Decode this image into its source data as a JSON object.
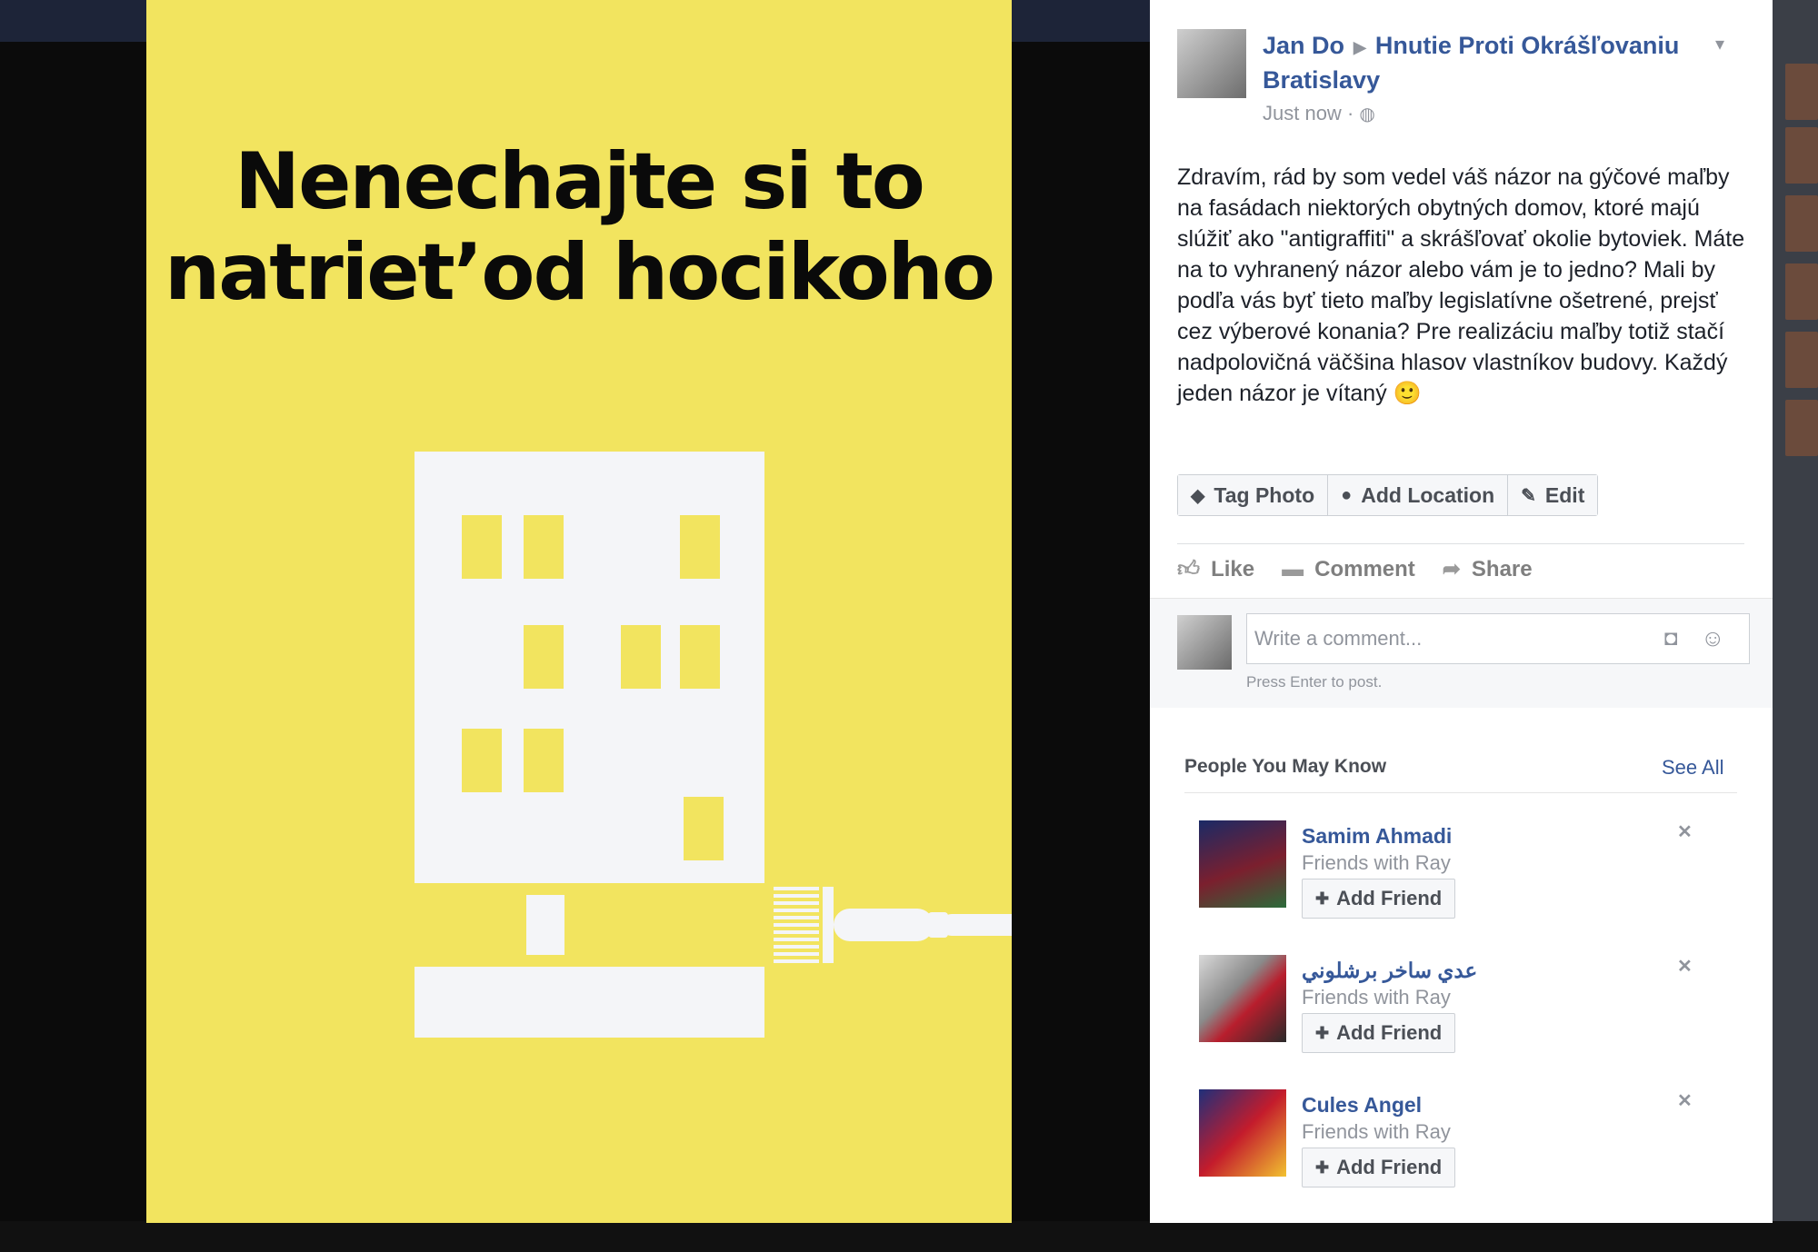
{
  "poster": {
    "line1": "Nenechajte si to",
    "line2": "natriet’od hocikoho",
    "background_color": "#f2e45f",
    "building_color": "#f4f5f8"
  },
  "post": {
    "author": "Jan Do",
    "group": "Hnutie Proti Okrášľovaniu Bratislavy",
    "time": "Just now",
    "separator": "·",
    "text": "Zdravím, rád by som vedel váš názor na gýčové maľby na fasádach niektorých obytných domov, ktoré majú slúžiť ako \"antigraffiti\" a skrášľovať okolie bytoviek. Máte na to vyhranený názor alebo vám je to jedno? Mali by podľa vás byť tieto maľby legislatívne ošetrené, prejsť cez výberové konania? Pre realizáciu maľby totiž stačí nadpolovičná väčšina hlasov vlastníkov budovy. Každý jeden názor je vítaný 🙂"
  },
  "toolbar": {
    "tag_photo": "Tag Photo",
    "add_location": "Add Location",
    "edit": "Edit"
  },
  "actions": {
    "like": "Like",
    "comment": "Comment",
    "share": "Share"
  },
  "comment_box": {
    "placeholder": "Write a comment...",
    "hint": "Press Enter to post."
  },
  "pymk": {
    "title": "People You May Know",
    "see_all": "See All",
    "people": [
      {
        "name": "Samim Ahmadi",
        "sub": "Friends with Ray",
        "button": "Add Friend"
      },
      {
        "name": "عدي ساخر برشلوني",
        "sub": "Friends with Ray",
        "button": "Add Friend"
      },
      {
        "name": "Cules Angel",
        "sub": "Friends with Ray",
        "button": "Add Friend"
      }
    ]
  },
  "icons": {
    "globe": "globe-icon",
    "tag": "tag-icon",
    "location": "location-pin-icon",
    "edit": "pencil-icon",
    "like": "thumbs-up-icon",
    "comment": "speech-bubble-icon",
    "share": "share-arrow-icon",
    "camera": "camera-icon",
    "emoji": "smiley-icon",
    "close": "close-icon",
    "add_friend": "add-friend-icon"
  },
  "colors": {
    "link": "#365899",
    "muted": "#90949c",
    "text": "#1d2129"
  }
}
